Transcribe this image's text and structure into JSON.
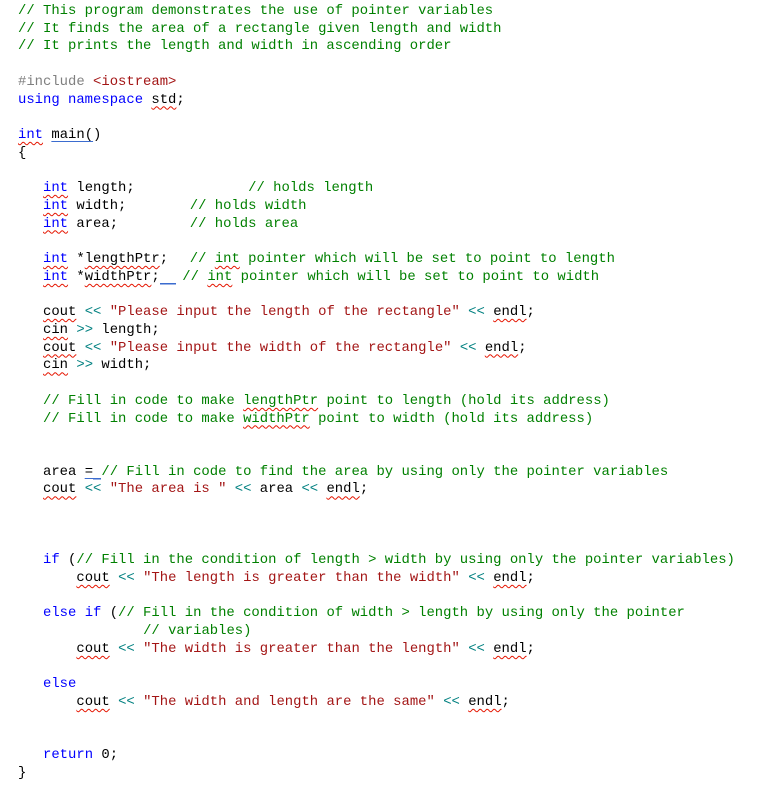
{
  "editor": {
    "language": "cpp",
    "colors": {
      "comment": "#008000",
      "keyword": "#0000ff",
      "string": "#a31515",
      "preprocessor": "#808080",
      "operator": "#008080",
      "plain": "#000000",
      "error_squiggle": "#e51400",
      "info_underline": "#3b6ccf"
    },
    "lines": [
      {
        "segs": [
          {
            "col": 0,
            "t": [
              [
                "comment",
                "// This program demonstrates the use of pointer variables"
              ]
            ]
          }
        ]
      },
      {
        "segs": [
          {
            "col": 0,
            "t": [
              [
                "comment",
                "// It finds the area of a rectangle given length and width"
              ]
            ]
          }
        ]
      },
      {
        "segs": [
          {
            "col": 0,
            "t": [
              [
                "comment",
                "// It prints the length and width in ascending order"
              ]
            ]
          }
        ]
      },
      {
        "segs": []
      },
      {
        "segs": [
          {
            "col": 0,
            "t": [
              [
                "preproc",
                "#include "
              ],
              [
                "include",
                "<iostream>"
              ]
            ]
          }
        ]
      },
      {
        "segs": [
          {
            "col": 0,
            "t": [
              [
                "keyword",
                "using namespace "
              ],
              [
                "plain",
                "std",
                "squiggle"
              ],
              [
                "plain",
                ";"
              ]
            ]
          }
        ]
      },
      {
        "segs": []
      },
      {
        "segs": [
          {
            "col": 0,
            "t": [
              [
                "keyword",
                "int",
                "squiggle"
              ],
              [
                "plain",
                " "
              ],
              [
                "plain",
                "main(",
                "blue-underline"
              ],
              [
                "plain",
                ")"
              ]
            ]
          }
        ]
      },
      {
        "segs": [
          {
            "col": 0,
            "t": [
              [
                "plain",
                "{"
              ]
            ]
          }
        ]
      },
      {
        "segs": []
      },
      {
        "segs": [
          {
            "col": 3,
            "t": [
              [
                "keyword",
                "int",
                "squiggle"
              ],
              [
                "plain",
                " length;"
              ]
            ]
          },
          {
            "col": 27.6,
            "t": [
              [
                "comment",
                "// holds length"
              ]
            ]
          }
        ]
      },
      {
        "segs": [
          {
            "col": 3,
            "t": [
              [
                "keyword",
                "int",
                "squiggle"
              ],
              [
                "plain",
                " width;"
              ]
            ]
          },
          {
            "col": 20.6,
            "t": [
              [
                "comment",
                "// holds width"
              ]
            ]
          }
        ]
      },
      {
        "segs": [
          {
            "col": 3,
            "t": [
              [
                "keyword",
                "int",
                "squiggle"
              ],
              [
                "plain",
                " area;"
              ]
            ]
          },
          {
            "col": 20.6,
            "t": [
              [
                "comment",
                "// holds area"
              ]
            ]
          }
        ]
      },
      {
        "segs": []
      },
      {
        "segs": [
          {
            "col": 3,
            "t": [
              [
                "keyword",
                "int",
                "squiggle"
              ],
              [
                "plain",
                " *"
              ],
              [
                "plain",
                "lengthPtr",
                "squiggle"
              ],
              [
                "plain",
                ";"
              ]
            ]
          },
          {
            "col": 20.6,
            "t": [
              [
                "comment",
                "// "
              ],
              [
                "comment",
                "int",
                "squiggle"
              ],
              [
                "comment",
                " pointer which will be set to point to length"
              ]
            ]
          }
        ]
      },
      {
        "segs": [
          {
            "col": 3,
            "t": [
              [
                "keyword",
                "int",
                "squiggle"
              ],
              [
                "plain",
                " *"
              ],
              [
                "plain",
                "widthPtr",
                "squiggle"
              ],
              [
                "plain",
                ";"
              ],
              [
                "gap",
                "  "
              ]
            ]
          },
          {
            "col": 19.7,
            "t": [
              [
                "comment",
                "// "
              ],
              [
                "comment",
                "int",
                "squiggle"
              ],
              [
                "comment",
                " pointer which will be set to point to width"
              ]
            ]
          }
        ]
      },
      {
        "segs": []
      },
      {
        "segs": [
          {
            "col": 3,
            "t": [
              [
                "plain",
                "cout",
                "squiggle"
              ],
              [
                "plain",
                " "
              ],
              [
                "op",
                "<<"
              ],
              [
                "plain",
                " "
              ],
              [
                "string",
                "\"Please input the length of the rectangle\""
              ],
              [
                "plain",
                " "
              ],
              [
                "op",
                "<<"
              ],
              [
                "plain",
                " "
              ],
              [
                "plain",
                "endl",
                "squiggle"
              ],
              [
                "plain",
                ";"
              ]
            ]
          }
        ]
      },
      {
        "segs": [
          {
            "col": 3,
            "t": [
              [
                "plain",
                "cin",
                "squiggle"
              ],
              [
                "plain",
                " "
              ],
              [
                "op",
                ">>"
              ],
              [
                "plain",
                " length;"
              ]
            ]
          }
        ]
      },
      {
        "segs": [
          {
            "col": 3,
            "t": [
              [
                "plain",
                "cout",
                "squiggle"
              ],
              [
                "plain",
                " "
              ],
              [
                "op",
                "<<"
              ],
              [
                "plain",
                " "
              ],
              [
                "string",
                "\"Please input the width of the rectangle\""
              ],
              [
                "plain",
                " "
              ],
              [
                "op",
                "<<"
              ],
              [
                "plain",
                " "
              ],
              [
                "plain",
                "endl",
                "squiggle"
              ],
              [
                "plain",
                ";"
              ]
            ]
          }
        ]
      },
      {
        "segs": [
          {
            "col": 3,
            "t": [
              [
                "plain",
                "cin",
                "squiggle"
              ],
              [
                "plain",
                " "
              ],
              [
                "op",
                ">>"
              ],
              [
                "plain",
                " width;"
              ]
            ]
          }
        ]
      },
      {
        "segs": []
      },
      {
        "segs": [
          {
            "col": 3,
            "t": [
              [
                "comment",
                "// Fill in code to make "
              ],
              [
                "comment",
                "lengthPtr",
                "squiggle"
              ],
              [
                "comment",
                " point to length (hold its address)"
              ]
            ]
          }
        ]
      },
      {
        "segs": [
          {
            "col": 3,
            "t": [
              [
                "comment",
                "// Fill in code to make "
              ],
              [
                "comment",
                "widthPtr",
                "squiggle"
              ],
              [
                "comment",
                " point to width (hold its address)"
              ]
            ]
          }
        ]
      },
      {
        "segs": []
      },
      {
        "segs": []
      },
      {
        "segs": [
          {
            "col": 3,
            "t": [
              [
                "plain",
                "area "
              ],
              [
                "plain",
                "=",
                "blue-underline"
              ],
              [
                "gap",
                " "
              ],
              [
                "comment",
                "// Fill in code to find the area by using only the pointer variables"
              ]
            ]
          }
        ]
      },
      {
        "segs": [
          {
            "col": 3,
            "t": [
              [
                "plain",
                "cout",
                "squiggle"
              ],
              [
                "plain",
                " "
              ],
              [
                "op",
                "<<"
              ],
              [
                "plain",
                " "
              ],
              [
                "string",
                "\"The area is \""
              ],
              [
                "plain",
                " "
              ],
              [
                "op",
                "<<"
              ],
              [
                "plain",
                " area "
              ],
              [
                "op",
                "<<"
              ],
              [
                "plain",
                " "
              ],
              [
                "plain",
                "endl",
                "squiggle"
              ],
              [
                "plain",
                ";"
              ]
            ]
          }
        ]
      },
      {
        "segs": []
      },
      {
        "segs": []
      },
      {
        "segs": []
      },
      {
        "segs": [
          {
            "col": 3,
            "t": [
              [
                "keyword",
                "if"
              ],
              [
                "plain",
                " ("
              ],
              [
                "comment",
                "// Fill in the condition of length > width by using only the pointer variables)"
              ]
            ]
          }
        ]
      },
      {
        "segs": [
          {
            "col": 7,
            "t": [
              [
                "plain",
                "cout",
                "squiggle"
              ],
              [
                "plain",
                " "
              ],
              [
                "op",
                "<<"
              ],
              [
                "plain",
                " "
              ],
              [
                "string",
                "\"The length is greater than the width\""
              ],
              [
                "plain",
                " "
              ],
              [
                "op",
                "<<"
              ],
              [
                "plain",
                " "
              ],
              [
                "plain",
                "endl",
                "squiggle"
              ],
              [
                "plain",
                ";"
              ]
            ]
          }
        ]
      },
      {
        "segs": []
      },
      {
        "segs": [
          {
            "col": 3,
            "t": [
              [
                "keyword",
                "else if"
              ],
              [
                "plain",
                " ("
              ],
              [
                "comment",
                "// Fill in the condition of width > length by using only the pointer"
              ]
            ]
          }
        ]
      },
      {
        "segs": [
          {
            "col": 15,
            "t": [
              [
                "comment",
                "// variables)"
              ]
            ]
          }
        ]
      },
      {
        "segs": [
          {
            "col": 7,
            "t": [
              [
                "plain",
                "cout",
                "squiggle"
              ],
              [
                "plain",
                " "
              ],
              [
                "op",
                "<<"
              ],
              [
                "plain",
                " "
              ],
              [
                "string",
                "\"The width is greater than the length\""
              ],
              [
                "plain",
                " "
              ],
              [
                "op",
                "<<"
              ],
              [
                "plain",
                " "
              ],
              [
                "plain",
                "endl",
                "squiggle"
              ],
              [
                "plain",
                ";"
              ]
            ]
          }
        ]
      },
      {
        "segs": []
      },
      {
        "segs": [
          {
            "col": 3,
            "t": [
              [
                "keyword",
                "else"
              ]
            ]
          }
        ]
      },
      {
        "segs": [
          {
            "col": 7,
            "t": [
              [
                "plain",
                "cout",
                "squiggle"
              ],
              [
                "plain",
                " "
              ],
              [
                "op",
                "<<"
              ],
              [
                "plain",
                " "
              ],
              [
                "string",
                "\"The width and length are the same\""
              ],
              [
                "plain",
                " "
              ],
              [
                "op",
                "<<"
              ],
              [
                "plain",
                " "
              ],
              [
                "plain",
                "endl",
                "squiggle"
              ],
              [
                "plain",
                ";"
              ]
            ]
          }
        ]
      },
      {
        "segs": []
      },
      {
        "segs": []
      },
      {
        "segs": [
          {
            "col": 3,
            "t": [
              [
                "keyword",
                "return"
              ],
              [
                "plain",
                " 0;"
              ]
            ]
          }
        ]
      },
      {
        "segs": [
          {
            "col": 0,
            "t": [
              [
                "plain",
                "}"
              ]
            ]
          }
        ]
      }
    ]
  }
}
